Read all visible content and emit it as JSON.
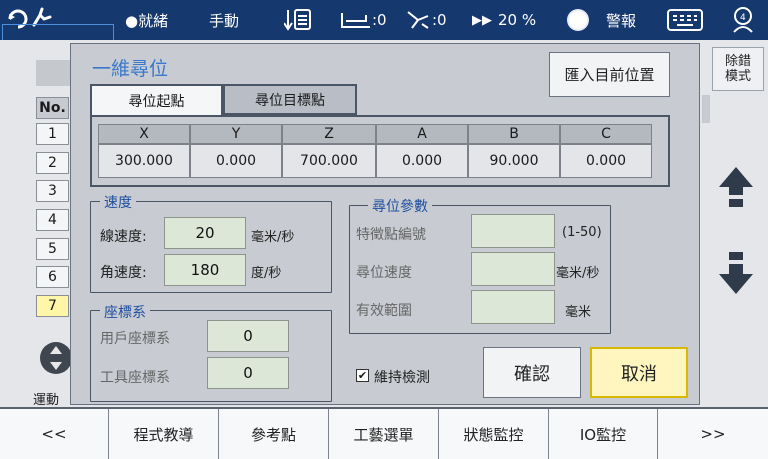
{
  "status": {
    "ready": "●就緒",
    "mode": "手動",
    "tool_count": ":0",
    "user_count": ":0",
    "speed": "20 %",
    "alarm": "警報"
  },
  "background": {
    "col_header": "No.",
    "rows": [
      "1",
      "2",
      "3",
      "4",
      "5",
      "6",
      "7"
    ],
    "clear_button": "除錯\n模式",
    "motion_label": "運動"
  },
  "dialog": {
    "title": "一維尋位",
    "import_button": "匯入目前位置",
    "tabs": [
      "尋位起點",
      "尋位目標點"
    ],
    "coord_headers": [
      "X",
      "Y",
      "Z",
      "A",
      "B",
      "C"
    ],
    "coord_values": [
      "300.000",
      "0.000",
      "700.000",
      "0.000",
      "90.000",
      "0.000"
    ],
    "speed_group": {
      "title": "速度",
      "linear_label": "線速度:",
      "linear_value": "20",
      "linear_unit": "毫米/秒",
      "angular_label": "角速度:",
      "angular_value": "180",
      "angular_unit": "度/秒"
    },
    "coord_group": {
      "title": "座標系",
      "user_label": "用戶座標系",
      "user_value": "0",
      "tool_label": "工具座標系",
      "tool_value": "0"
    },
    "search_group": {
      "title": "尋位參數",
      "feature_label": "特徵點編號",
      "feature_range": "(1-50)",
      "speed_label": "尋位速度",
      "speed_unit": "毫米/秒",
      "range_label": "有效範圍",
      "range_unit": "毫米"
    },
    "maintain_check": "維持檢測",
    "maintain_checked": true,
    "confirm_button": "確認",
    "cancel_button": "取消"
  },
  "bottom_nav": [
    "<<",
    "程式教導",
    "參考點",
    "工藝選單",
    "狀態監控",
    "IO監控",
    ">>"
  ]
}
